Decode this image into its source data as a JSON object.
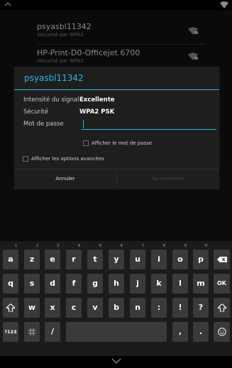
{
  "networks": [
    {
      "ssid": "psyasbl11342",
      "security": "Sécurisé par WPA2"
    },
    {
      "ssid": "HP-Print-D0-Officejet 6700",
      "security": "Sécurisé par WPA2"
    }
  ],
  "dialog": {
    "title": "psyasbl11342",
    "signal_label": "Intensité du signal",
    "signal_value": "Excellente",
    "security_label": "Sécurité",
    "security_value": "WPA2 PSK",
    "password_label": "Mot de passe",
    "password_value": "",
    "show_password_label": "Afficher le mot de passe",
    "advanced_label": "Afficher les options avancées",
    "cancel_label": "Annuler",
    "connect_label": "Se connecter"
  },
  "keyboard": {
    "row1": [
      {
        "k": "a",
        "h": "1"
      },
      {
        "k": "z",
        "h": "2"
      },
      {
        "k": "e",
        "h": "3"
      },
      {
        "k": "r",
        "h": "4"
      },
      {
        "k": "t",
        "h": "5"
      },
      {
        "k": "y",
        "h": "6"
      },
      {
        "k": "u",
        "h": "7"
      },
      {
        "k": "i",
        "h": "8"
      },
      {
        "k": "o",
        "h": "9"
      },
      {
        "k": "p",
        "h": "0"
      }
    ],
    "row2": [
      "q",
      "s",
      "d",
      "f",
      "g",
      "h",
      "j",
      "k",
      "l",
      "m"
    ],
    "ok_label": "OK",
    "row3": [
      "w",
      "x",
      "c",
      "v",
      "b",
      "n",
      ":",
      "!",
      "?"
    ],
    "sym_label": "?123",
    "slash_label": "/",
    "comma_label": ",",
    "period_label": "."
  },
  "colors": {
    "accent": "#33b5e5"
  }
}
